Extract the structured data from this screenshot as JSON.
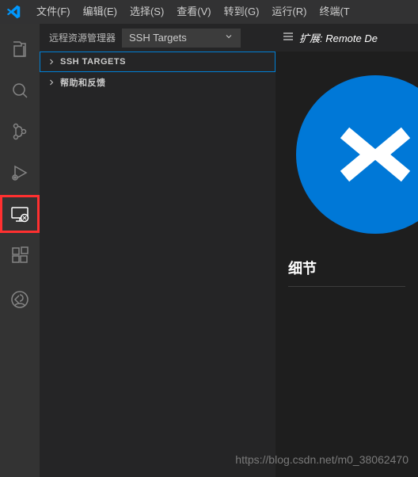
{
  "menu": {
    "file": "文件(F)",
    "edit": "编辑(E)",
    "select": "选择(S)",
    "view": "查看(V)",
    "go": "转到(G)",
    "run": "运行(R)",
    "terminal": "终端(T"
  },
  "sidebar": {
    "title": "远程资源管理器",
    "dropdown": {
      "selected": "SSH Targets"
    },
    "tree": {
      "section_head": "SSH TARGETS",
      "help": "帮助和反馈"
    }
  },
  "editor": {
    "tab_label": "扩展: Remote De",
    "section_title": "细节"
  },
  "watermark": "https://blog.csdn.net/m0_38062470"
}
